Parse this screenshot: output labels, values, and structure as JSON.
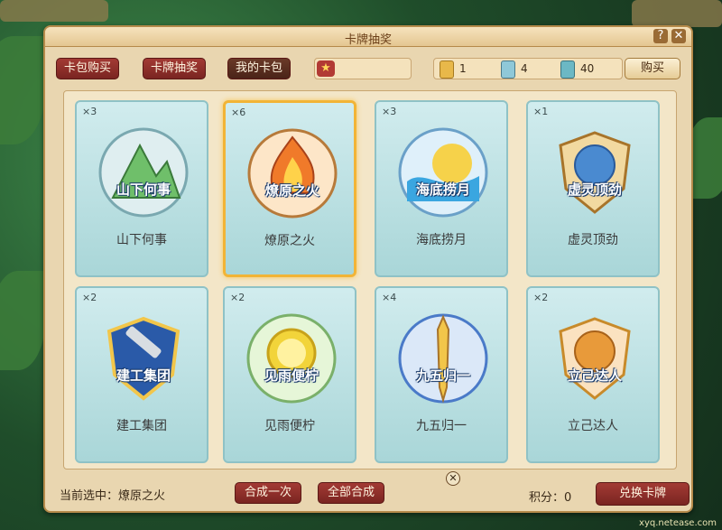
{
  "window": {
    "title": "卡牌抽奖",
    "help_label": "?",
    "close_label": "✕"
  },
  "toolbar": {
    "tabs": [
      {
        "label": "卡包购买"
      },
      {
        "label": "卡牌抽奖"
      },
      {
        "label": "我的卡包"
      }
    ],
    "currencies": [
      {
        "icon": "card-pack-gold-icon",
        "value": "1",
        "color": "#e8b84a"
      },
      {
        "icon": "card-pack-blue-icon",
        "value": "4",
        "color": "#8fc8d8"
      },
      {
        "icon": "card-pack-teal-icon",
        "value": "40",
        "color": "#6cb8c4"
      }
    ],
    "buy_label": "购买"
  },
  "cards": [
    {
      "count": "×3",
      "name": "山下何事",
      "emblem": "山下何事",
      "icon": "mountain-emblem-icon",
      "color": "#6fbf6a"
    },
    {
      "count": "×6",
      "name": "燎原之火",
      "emblem": "燎原之火",
      "icon": "fire-emblem-icon",
      "color": "#f07a2a"
    },
    {
      "count": "×3",
      "name": "海底捞月",
      "emblem": "海底捞月",
      "icon": "moon-wave-emblem-icon",
      "color": "#3aa6e0"
    },
    {
      "count": "×1",
      "name": "虚灵顶劲",
      "emblem": "虚灵顶劲",
      "icon": "shield-emblem-icon",
      "color": "#4a8ad0"
    },
    {
      "count": "×2",
      "name": "建工集团",
      "emblem": "建工集团",
      "icon": "wrench-emblem-icon",
      "color": "#3a78c8"
    },
    {
      "count": "×2",
      "name": "见雨便柠",
      "emblem": "见雨便柠",
      "icon": "lemon-emblem-icon",
      "color": "#f2d43a"
    },
    {
      "count": "×4",
      "name": "九五归一",
      "emblem": "九五归一",
      "icon": "sword-emblem-icon",
      "color": "#4a7ac8"
    },
    {
      "count": "×2",
      "name": "立己达人",
      "emblem": "立己达人",
      "icon": "fist-emblem-icon",
      "color": "#e89a3a"
    }
  ],
  "selected_index": 1,
  "bottom": {
    "current_label": "当前选中：",
    "current_value": "燎原之火",
    "merge_one_label": "合成一次",
    "merge_all_label": "全部合成",
    "close_label": "✕",
    "score_label": "积分：",
    "score_value": "0",
    "exchange_label": "兑换卡牌"
  },
  "watermark": "xyq.netease.com"
}
